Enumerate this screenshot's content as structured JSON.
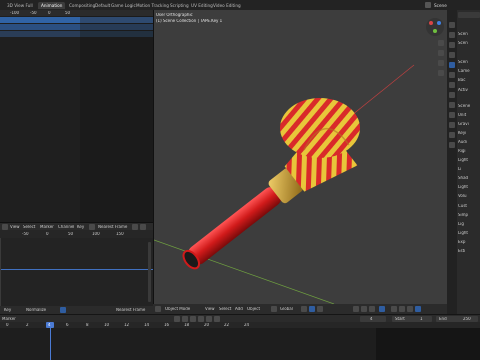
{
  "workspace_tabs": [
    "3D View Full",
    "Animation",
    "Compositing",
    "Default",
    "Game Logic",
    "Motion Tracking",
    "Scripting",
    "UV Editing",
    "Video Editing"
  ],
  "scene_label": "Scene",
  "left_top_ruler": [
    "-100",
    "-50",
    "0",
    "50"
  ],
  "graph_menu": [
    "View",
    "Select",
    "Marker",
    "Channel",
    "Key"
  ],
  "graph_dropdown": "Nearest Frame",
  "graph_ruler": [
    "-50",
    "0",
    "50",
    "100",
    "150"
  ],
  "graph_footer_menu": [
    "Key"
  ],
  "graph_footer_dropdown": "Nearest Frame",
  "graph_footer_mode": "Normalize",
  "viewport": {
    "title": "User Orthographic",
    "subtitle": "(1) Scene Collection | TAPE.Key 1"
  },
  "viewport_header": {
    "mode": "Object Mode",
    "menu": [
      "View",
      "Select",
      "Add",
      "Object"
    ],
    "transform": "Global"
  },
  "timeline": {
    "menu": [
      "Marker"
    ],
    "start_label": "Start",
    "start_value": "1",
    "end_label": "End",
    "end_value": "250",
    "current_frame": "4",
    "ruler": [
      "0",
      "2",
      "4",
      "6",
      "8",
      "10",
      "12",
      "14",
      "16",
      "18",
      "20",
      "22",
      "24"
    ]
  },
  "props_labels": [
    "Scen",
    "Scen",
    "Scen",
    "Came",
    "Bac",
    "Activ",
    "Scene",
    "Unit",
    "Gravi",
    "Keyi",
    "Audi",
    "Rigi",
    "Light",
    "Li",
    "Shad",
    "Light",
    "Volu",
    "Cust",
    "Simp",
    "Lig",
    "Light",
    "Exp",
    "Esti"
  ],
  "colors": {
    "accent": "#2f5da0",
    "selected_row": "#3063a5",
    "playhead": "#4b7bd4",
    "horn_red": "#d92a2a",
    "horn_yellow": "#e8c63a",
    "brass": "#c99a2e"
  }
}
